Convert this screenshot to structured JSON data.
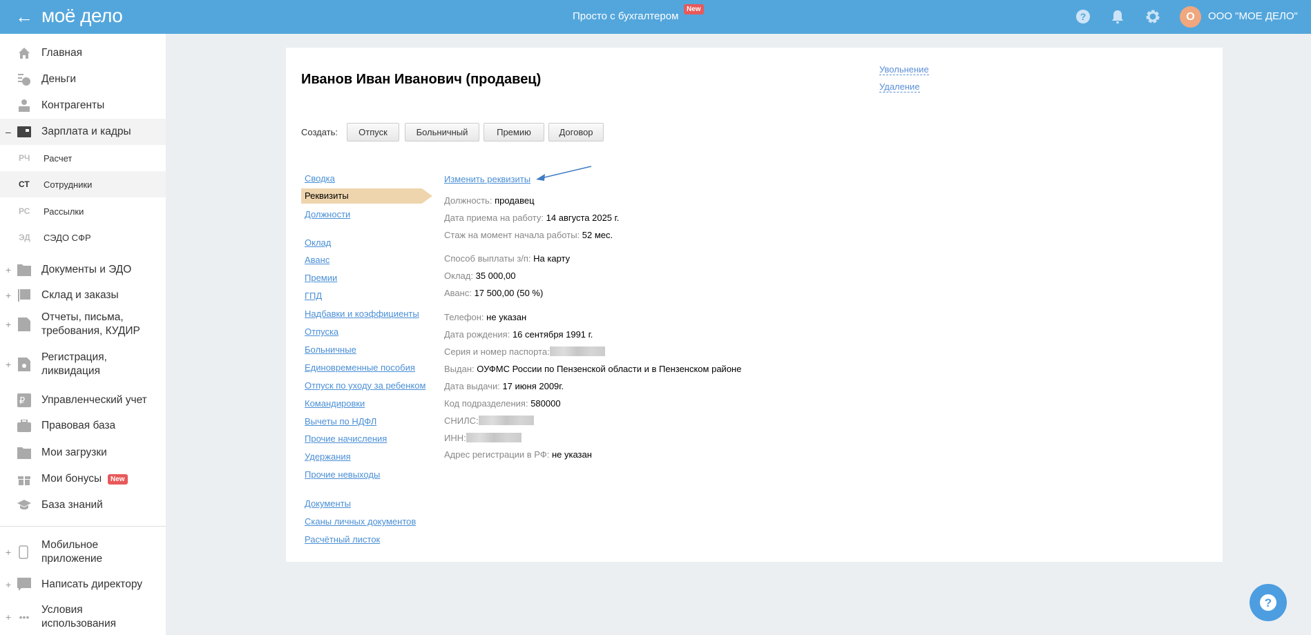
{
  "header": {
    "back_icon": "arrow-left-icon",
    "logo": "моё дело",
    "center_link": "Просто с бухгалтером",
    "center_badge": "New",
    "avatar_letter": "О",
    "org_name": "ООО \"МОЕ ДЕЛО\"",
    "color": "#53a6dc"
  },
  "sidebar": {
    "items_top": [
      {
        "label": "Главная",
        "icon": "home-icon"
      },
      {
        "label": "Деньги",
        "icon": "money-icon"
      },
      {
        "label": "Контрагенты",
        "icon": "contractor-icon"
      },
      {
        "label": "Зарплата и кадры",
        "icon": "wallet-icon",
        "expander": "–"
      }
    ],
    "subitems": [
      {
        "abbr": "РЧ",
        "label": "Расчет"
      },
      {
        "abbr": "СТ",
        "label": "Сотрудники"
      },
      {
        "abbr": "РС",
        "label": "Рассылки"
      },
      {
        "abbr": "ЭД",
        "label": "СЭДО СФР"
      }
    ],
    "items_mid": [
      {
        "label": "Документы и ЭДО",
        "expander": "+"
      },
      {
        "label": "Склад и заказы",
        "expander": "+"
      },
      {
        "label": "Отчеты, письма, требования, КУДИР",
        "expander": "+"
      },
      {
        "label": "Регистрация, ликвидация",
        "expander": "+"
      },
      {
        "label": "Управленческий учет"
      },
      {
        "label": "Правовая база"
      },
      {
        "label": "Мои загрузки"
      },
      {
        "label": "Мои бонусы",
        "badge": "New"
      },
      {
        "label": "База знаний"
      }
    ],
    "items_bottom": [
      {
        "label": "Мобильное приложение",
        "expander": "+"
      },
      {
        "label": "Написать директору",
        "expander": "+"
      },
      {
        "label": "Условия использования",
        "expander": "+"
      }
    ]
  },
  "page": {
    "title": "Иванов Иван Иванович (продавец)",
    "actions": {
      "dismiss": "Увольнение",
      "delete": "Удаление"
    },
    "create": {
      "label": "Создать:",
      "buttons": [
        "Отпуск",
        "Больничный",
        "Премию",
        "Договор"
      ]
    },
    "nav": {
      "group1": [
        "Сводка",
        "Реквизиты",
        "Должности"
      ],
      "active": "Реквизиты",
      "group2": [
        "Оклад",
        "Аванс",
        "Премии",
        "ГПД",
        "Надбавки и коэффициенты",
        "Отпуска",
        "Больничные",
        "Единовременные пособия",
        "Отпуск по уходу за ребенком",
        "Командировки",
        "Вычеты по НДФЛ",
        "Прочие начисления",
        "Удержания",
        "Прочие невыходы"
      ],
      "group3": [
        "Документы",
        "Сканы личных документов",
        "Расчётный листок"
      ]
    },
    "edit_link": "Изменить реквизиты",
    "details": [
      {
        "k": "Должность:",
        "v": "продавец"
      },
      {
        "k": "Дата приема на работу:",
        "v": "14 августа 2025 г."
      },
      {
        "k": "Стаж на момент начала работы:",
        "v": "52 мес."
      },
      {
        "k": "Способ выплаты з/п:",
        "v": "На карту"
      },
      {
        "k": "Оклад:",
        "v": "35 000,00"
      },
      {
        "k": "Аванс:",
        "v": "17 500,00 (50 %)"
      },
      {
        "k": "Телефон:",
        "v": "не указан"
      },
      {
        "k": "Дата рождения:",
        "v": "16 сентября 1991 г."
      },
      {
        "k": "Серия и номер паспорта:",
        "v": null,
        "blurred": true
      },
      {
        "k": "Выдан:",
        "v": "ОУФМС России по Пензенской области и в Пензенском районе"
      },
      {
        "k": "Дата выдачи:",
        "v": "17 июня 2009г."
      },
      {
        "k": "Код подразделения:",
        "v": "580000"
      },
      {
        "k": "СНИЛС:",
        "v": null,
        "blurred": true
      },
      {
        "k": "ИНН:",
        "v": null,
        "blurred": true
      },
      {
        "k": "Адрес регистрации в РФ:",
        "v": "не указан"
      }
    ]
  }
}
